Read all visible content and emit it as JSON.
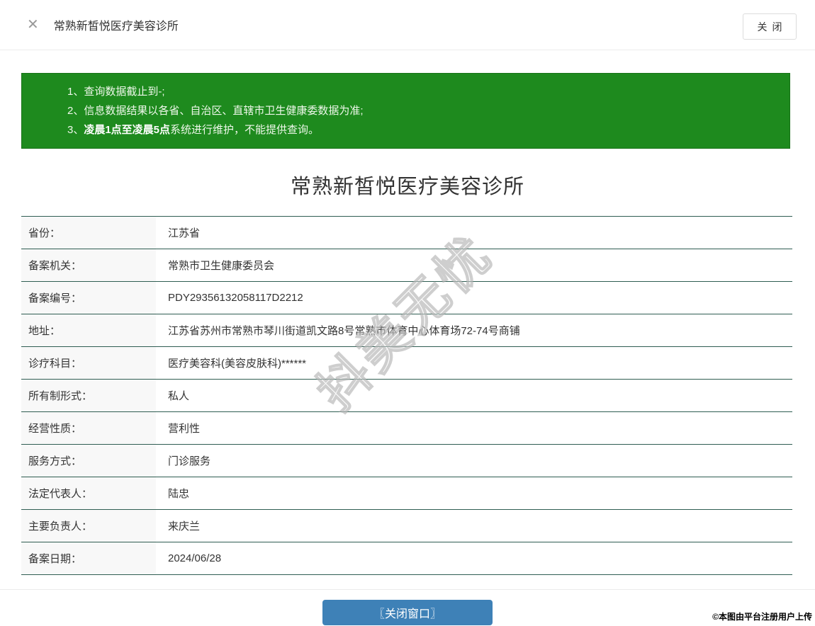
{
  "colors": {
    "notice_green": "#1e8a1e",
    "table_border": "#2f5d52",
    "button_blue": "#3e81b7"
  },
  "header": {
    "close_icon": "✕",
    "title": "常熟新皙悦医疗美容诊所",
    "close_button_label": "关闭"
  },
  "notice": {
    "line1": "1、查询数据截止到-;",
    "line2": "2、信息数据结果以各省、自治区、直辖市卫生健康委数据为准;",
    "line3_prefix": "3、",
    "line3_bold": "凌晨1点至凌晨5点",
    "line3_rest": "系统进行维护，不能提供查询。"
  },
  "main": {
    "title": "常熟新皙悦医疗美容诊所",
    "table": {
      "rows": [
        {
          "label": "省份：",
          "value": "江苏省"
        },
        {
          "label": "备案机关：",
          "value": "常熟市卫生健康委员会"
        },
        {
          "label": "备案编号：",
          "value": "PDY29356132058117D2212"
        },
        {
          "label": "地址：",
          "value": "江苏省苏州市常熟市琴川街道凯文路8号常熟市体育中心体育场72-74号商铺"
        },
        {
          "label": "诊疗科目：",
          "value": "医疗美容科(美容皮肤科)******"
        },
        {
          "label": "所有制形式：",
          "value": "私人"
        },
        {
          "label": "经营性质：",
          "value": "营利性"
        },
        {
          "label": "服务方式：",
          "value": "门诊服务"
        },
        {
          "label": "法定代表人：",
          "value": "陆忠"
        },
        {
          "label": "主要负责人：",
          "value": "来庆兰"
        },
        {
          "label": "备案日期：",
          "value": "2024/06/28"
        }
      ]
    },
    "close_window_button": "〖关闭窗口〗"
  },
  "watermark": "抖美无忧",
  "footer": {
    "copyright": "©本图由平台注册用户上传"
  }
}
